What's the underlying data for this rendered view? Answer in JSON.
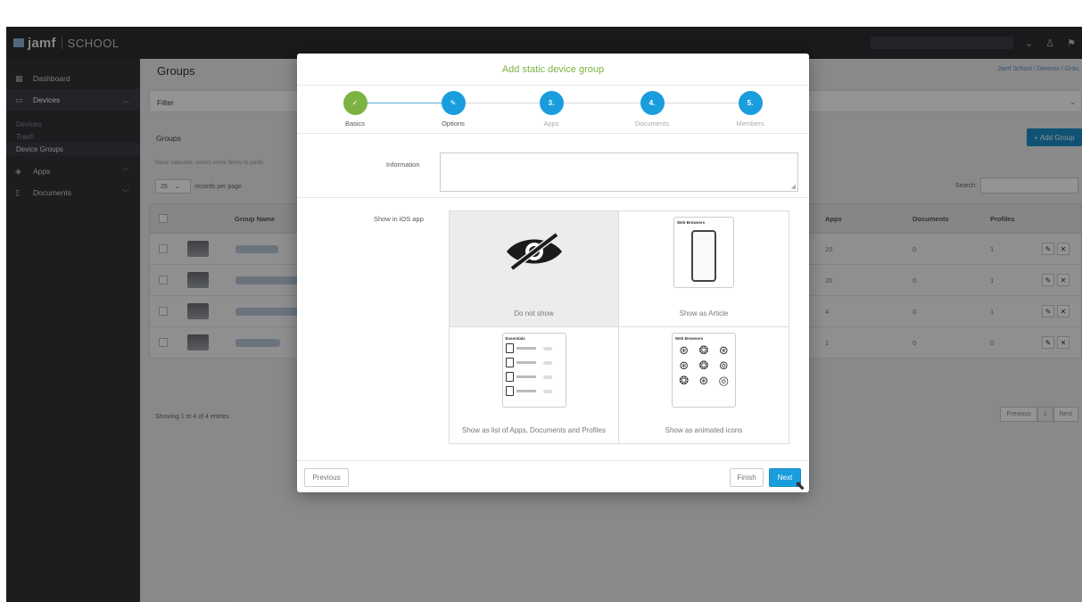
{
  "brand": {
    "word1": "jamf",
    "word2": "SCHOOL"
  },
  "sidebar": {
    "items": [
      {
        "label": "Dashboard",
        "icon": "grid-icon"
      },
      {
        "label": "Devices",
        "icon": "monitor-icon"
      },
      {
        "label": "Apps",
        "icon": "layers-icon"
      },
      {
        "label": "Documents",
        "icon": "document-icon"
      }
    ],
    "devices_sub": [
      "Devices",
      "Trash",
      "Device Groups"
    ]
  },
  "main": {
    "title": "Groups",
    "breadcrumb": "Jamf School  /  Devices  /  Grou",
    "filter_label": "Filter",
    "groups_label": "Groups",
    "add_group": "+ Add Group",
    "hint": "None selected, select some items to perfo",
    "rpp_value": "25",
    "rpp_label": "records per page",
    "search_label": "Search:",
    "columns": {
      "group_name": "Group Name",
      "apps": "Apps",
      "documents": "Documents",
      "profiles": "Profiles"
    },
    "rows": [
      {
        "apps": "20",
        "documents": "0",
        "profiles": "1"
      },
      {
        "apps": "20",
        "documents": "0",
        "profiles": "1"
      },
      {
        "apps": "4",
        "documents": "0",
        "profiles": "1"
      },
      {
        "apps": "1",
        "documents": "0",
        "profiles": "0"
      }
    ],
    "showing": "Showing 1 to 4 of 4 entries",
    "pager": {
      "prev": "Previous",
      "page": "1",
      "next": "Next"
    }
  },
  "modal": {
    "title": "Add static device group",
    "steps": [
      {
        "label": "Basics",
        "mark": "✓"
      },
      {
        "label": "Options",
        "mark": "✎"
      },
      {
        "label": "Apps",
        "mark": "3."
      },
      {
        "label": "Documents",
        "mark": "4."
      },
      {
        "label": "Members",
        "mark": "5."
      }
    ],
    "information_label": "Information",
    "information_value": "",
    "show_in_ios_label": "Show in iOS app",
    "options": [
      {
        "label": "Do not show",
        "selected": true
      },
      {
        "label": "Show as Article",
        "card_title": "Web Browsers",
        "selected": false
      },
      {
        "label": "Show as list of Apps, Documents and Profiles",
        "card_title": "Essentials",
        "selected": false
      },
      {
        "label": "Show as animated icons",
        "card_title": "Web Browsers",
        "selected": false
      }
    ],
    "buttons": {
      "previous": "Previous",
      "finish": "Finish",
      "next": "Next"
    }
  },
  "colors": {
    "accent_blue": "#1a9ddd",
    "success_green": "#7cb342",
    "sidebar_bg": "#2f3236"
  }
}
